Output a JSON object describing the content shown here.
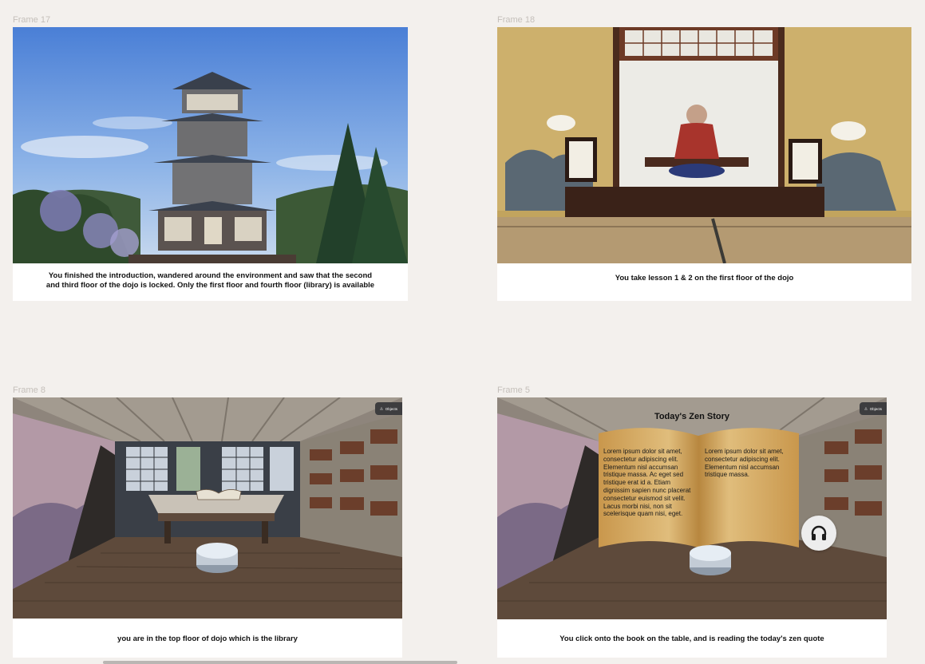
{
  "frames": {
    "f17": {
      "label": "Frame 17",
      "caption_line1": "You finished the introduction, wandered around the environment and saw that the second",
      "caption_line2": "and third floor of the dojo is locked. Only the first floor and fourth floor (library) is available",
      "scene": "dojo-tower-exterior"
    },
    "f18": {
      "label": "Frame 18",
      "caption": "You take lesson 1 & 2 on the first floor of the dojo",
      "scene": "meditation-master-room"
    },
    "f8": {
      "label": "Frame 8",
      "caption": "you are in the top floor of dojo which is the library",
      "objects_label": "Objects",
      "scene": "library-room"
    },
    "f5": {
      "label": "Frame 5",
      "caption": "You click onto the  book on the table, and is reading the today's zen quote",
      "objects_label": "Objects",
      "book_title": "Today's Zen Story",
      "left_page": "Lorem ipsum dolor sit amet, consectetur adipiscing elit. Elementum nisl accumsan tristique massa. Ac eget sed tristique erat id a. Etiam dignissim sapien nunc placerat consectetur euismod sit velit. Lacus morbi nisi, non sit scelerisque quam nisi, eget.",
      "right_page": "Lorem ipsum dolor sit amet, consectetur adipiscing elit. Elementum nisl accumsan tristique massa.",
      "audio_icon": "headphones-icon"
    }
  },
  "colors": {
    "canvas": "#f3f0ed",
    "frame_label": "#c4bfba",
    "sky": "#5b8fe0",
    "wall_gold": "#c9a85c",
    "book_gold": "#d4a95e",
    "floor_wood": "#5a4636"
  }
}
